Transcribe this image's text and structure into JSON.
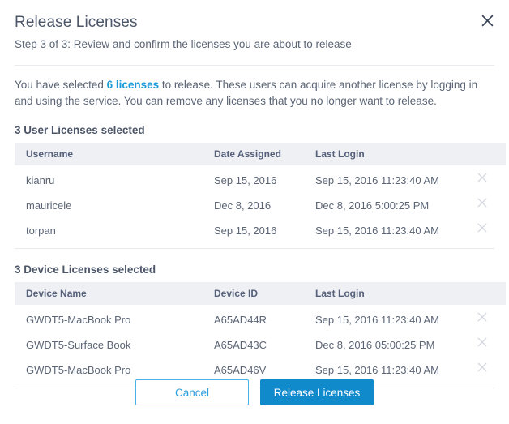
{
  "dialog": {
    "title": "Release Licenses",
    "subtitle": "Step 3 of 3: Review and confirm the licenses you are about to release",
    "close_icon": "close-icon"
  },
  "intro": {
    "before": "You have selected ",
    "highlight": "6 licenses",
    "after": " to release. These users can acquire another license by logging in and using the service. You can remove any licenses that you no longer want to release."
  },
  "users_section": {
    "title": "3 User Licenses selected",
    "columns": [
      "Username",
      "Date Assigned",
      "Last Login"
    ],
    "rows": [
      {
        "username": "kianru",
        "date_assigned": "Sep 15, 2016",
        "last_login": "Sep 15, 2016 11:23:40 AM",
        "remove_icon": "remove-icon"
      },
      {
        "username": "mauricele",
        "date_assigned": "Dec 8, 2016",
        "last_login": "Dec 8, 2016 5:00:25 PM",
        "remove_icon": "remove-icon"
      },
      {
        "username": "torpan",
        "date_assigned": "Sep 15, 2016",
        "last_login": "Sep 15, 2016 11:23:40 AM",
        "remove_icon": "remove-icon"
      }
    ]
  },
  "devices_section": {
    "title": "3 Device Licenses selected",
    "columns": [
      "Device Name",
      "Device ID",
      "Last Login"
    ],
    "rows": [
      {
        "device_name": "GWDT5-MacBook Pro",
        "device_id": "A65AD44R",
        "last_login": "Sep 15, 2016 11:23:40 AM",
        "remove_icon": "remove-icon"
      },
      {
        "device_name": "GWDT5-Surface Book",
        "device_id": "A65AD43C",
        "last_login": "Dec 8, 2016 05:00:25 PM",
        "remove_icon": "remove-icon"
      },
      {
        "device_name": "GWDT5-MacBook Pro",
        "device_id": "A65AD46V",
        "last_login": "Sep 15, 2016 11:23:40 AM",
        "remove_icon": "remove-icon"
      }
    ]
  },
  "footer": {
    "cancel_label": "Cancel",
    "confirm_label": "Release Licenses"
  },
  "colors": {
    "accent": "#118acb",
    "link": "#1c9bd8",
    "cancel_border": "#49b1e8",
    "header_row_bg": "#eff0f4",
    "rule": "#e9eaed",
    "text": "#5b6576",
    "heading": "#4c5668"
  }
}
